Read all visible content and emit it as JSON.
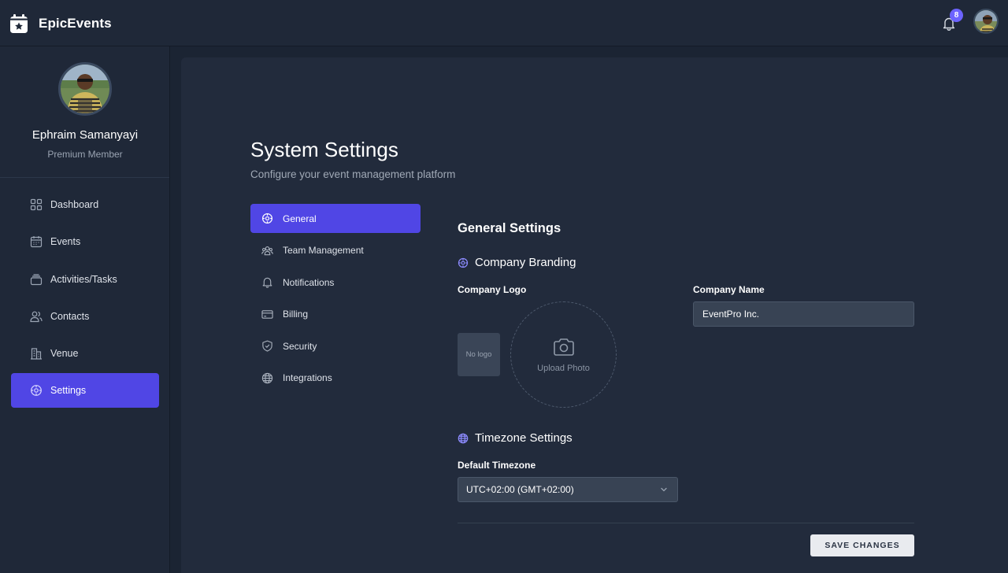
{
  "app": {
    "name": "EpicEvents"
  },
  "header": {
    "notification_count": "8"
  },
  "user": {
    "name": "Ephraim Samanyayi",
    "role": "Premium Member"
  },
  "sidebar": {
    "items": [
      {
        "label": "Dashboard",
        "icon": "grid-icon"
      },
      {
        "label": "Events",
        "icon": "calendar-icon"
      },
      {
        "label": "Activities/Tasks",
        "icon": "stack-icon"
      },
      {
        "label": "Contacts",
        "icon": "users-icon"
      },
      {
        "label": "Venue",
        "icon": "building-icon"
      },
      {
        "label": "Settings",
        "icon": "settings-icon",
        "active": true
      }
    ]
  },
  "page": {
    "title": "System Settings",
    "subtitle": "Configure your event management platform"
  },
  "settings_nav": {
    "items": [
      {
        "label": "General",
        "icon": "settings-icon",
        "active": true
      },
      {
        "label": "Team Management",
        "icon": "team-icon"
      },
      {
        "label": "Notifications",
        "icon": "bell-icon"
      },
      {
        "label": "Billing",
        "icon": "credit-card-icon"
      },
      {
        "label": "Security",
        "icon": "shield-icon"
      },
      {
        "label": "Integrations",
        "icon": "globe-icon"
      }
    ]
  },
  "general": {
    "title": "General Settings",
    "branding": {
      "heading": "Company Branding",
      "logo_label": "Company Logo",
      "no_logo_text": "No logo",
      "upload_text": "Upload Photo",
      "name_label": "Company Name",
      "name_value": "EventPro Inc."
    },
    "timezone": {
      "heading": "Timezone Settings",
      "label": "Default Timezone",
      "selected": "UTC+02:00 (GMT+02:00)"
    },
    "save_label": "SAVE CHANGES"
  },
  "colors": {
    "accent": "#5046e5",
    "background": "#1b2433",
    "panel": "#222b3c",
    "badge": "#6c63ff"
  }
}
